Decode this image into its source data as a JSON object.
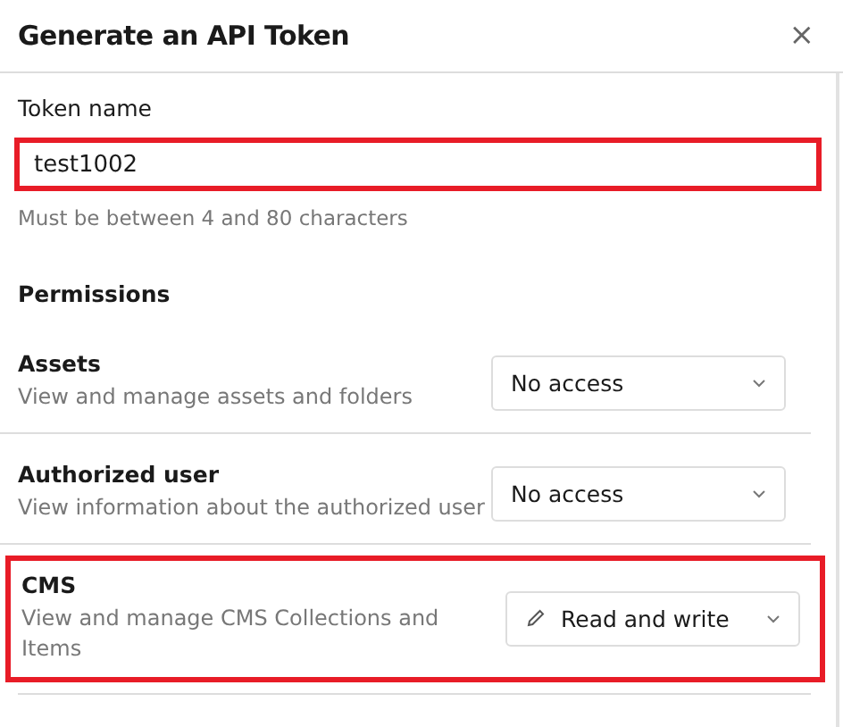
{
  "dialog": {
    "title": "Generate an API Token",
    "close_icon": "×"
  },
  "token_name": {
    "label": "Token name",
    "value": "test1002",
    "highlighted": true,
    "hint": "Must be between 4 and 80 characters"
  },
  "permissions": {
    "heading": "Permissions",
    "items": [
      {
        "name": "Assets",
        "description": "View and manage assets and folders",
        "access": "No access",
        "kind": "plain",
        "highlighted": false
      },
      {
        "name": "Authorized user",
        "description": "View information about the authorized user",
        "access": "No access",
        "kind": "plain",
        "highlighted": false
      },
      {
        "name": "CMS",
        "description": "View and manage CMS Collections and Items",
        "access": "Read and write",
        "kind": "write",
        "highlighted": true
      }
    ]
  }
}
